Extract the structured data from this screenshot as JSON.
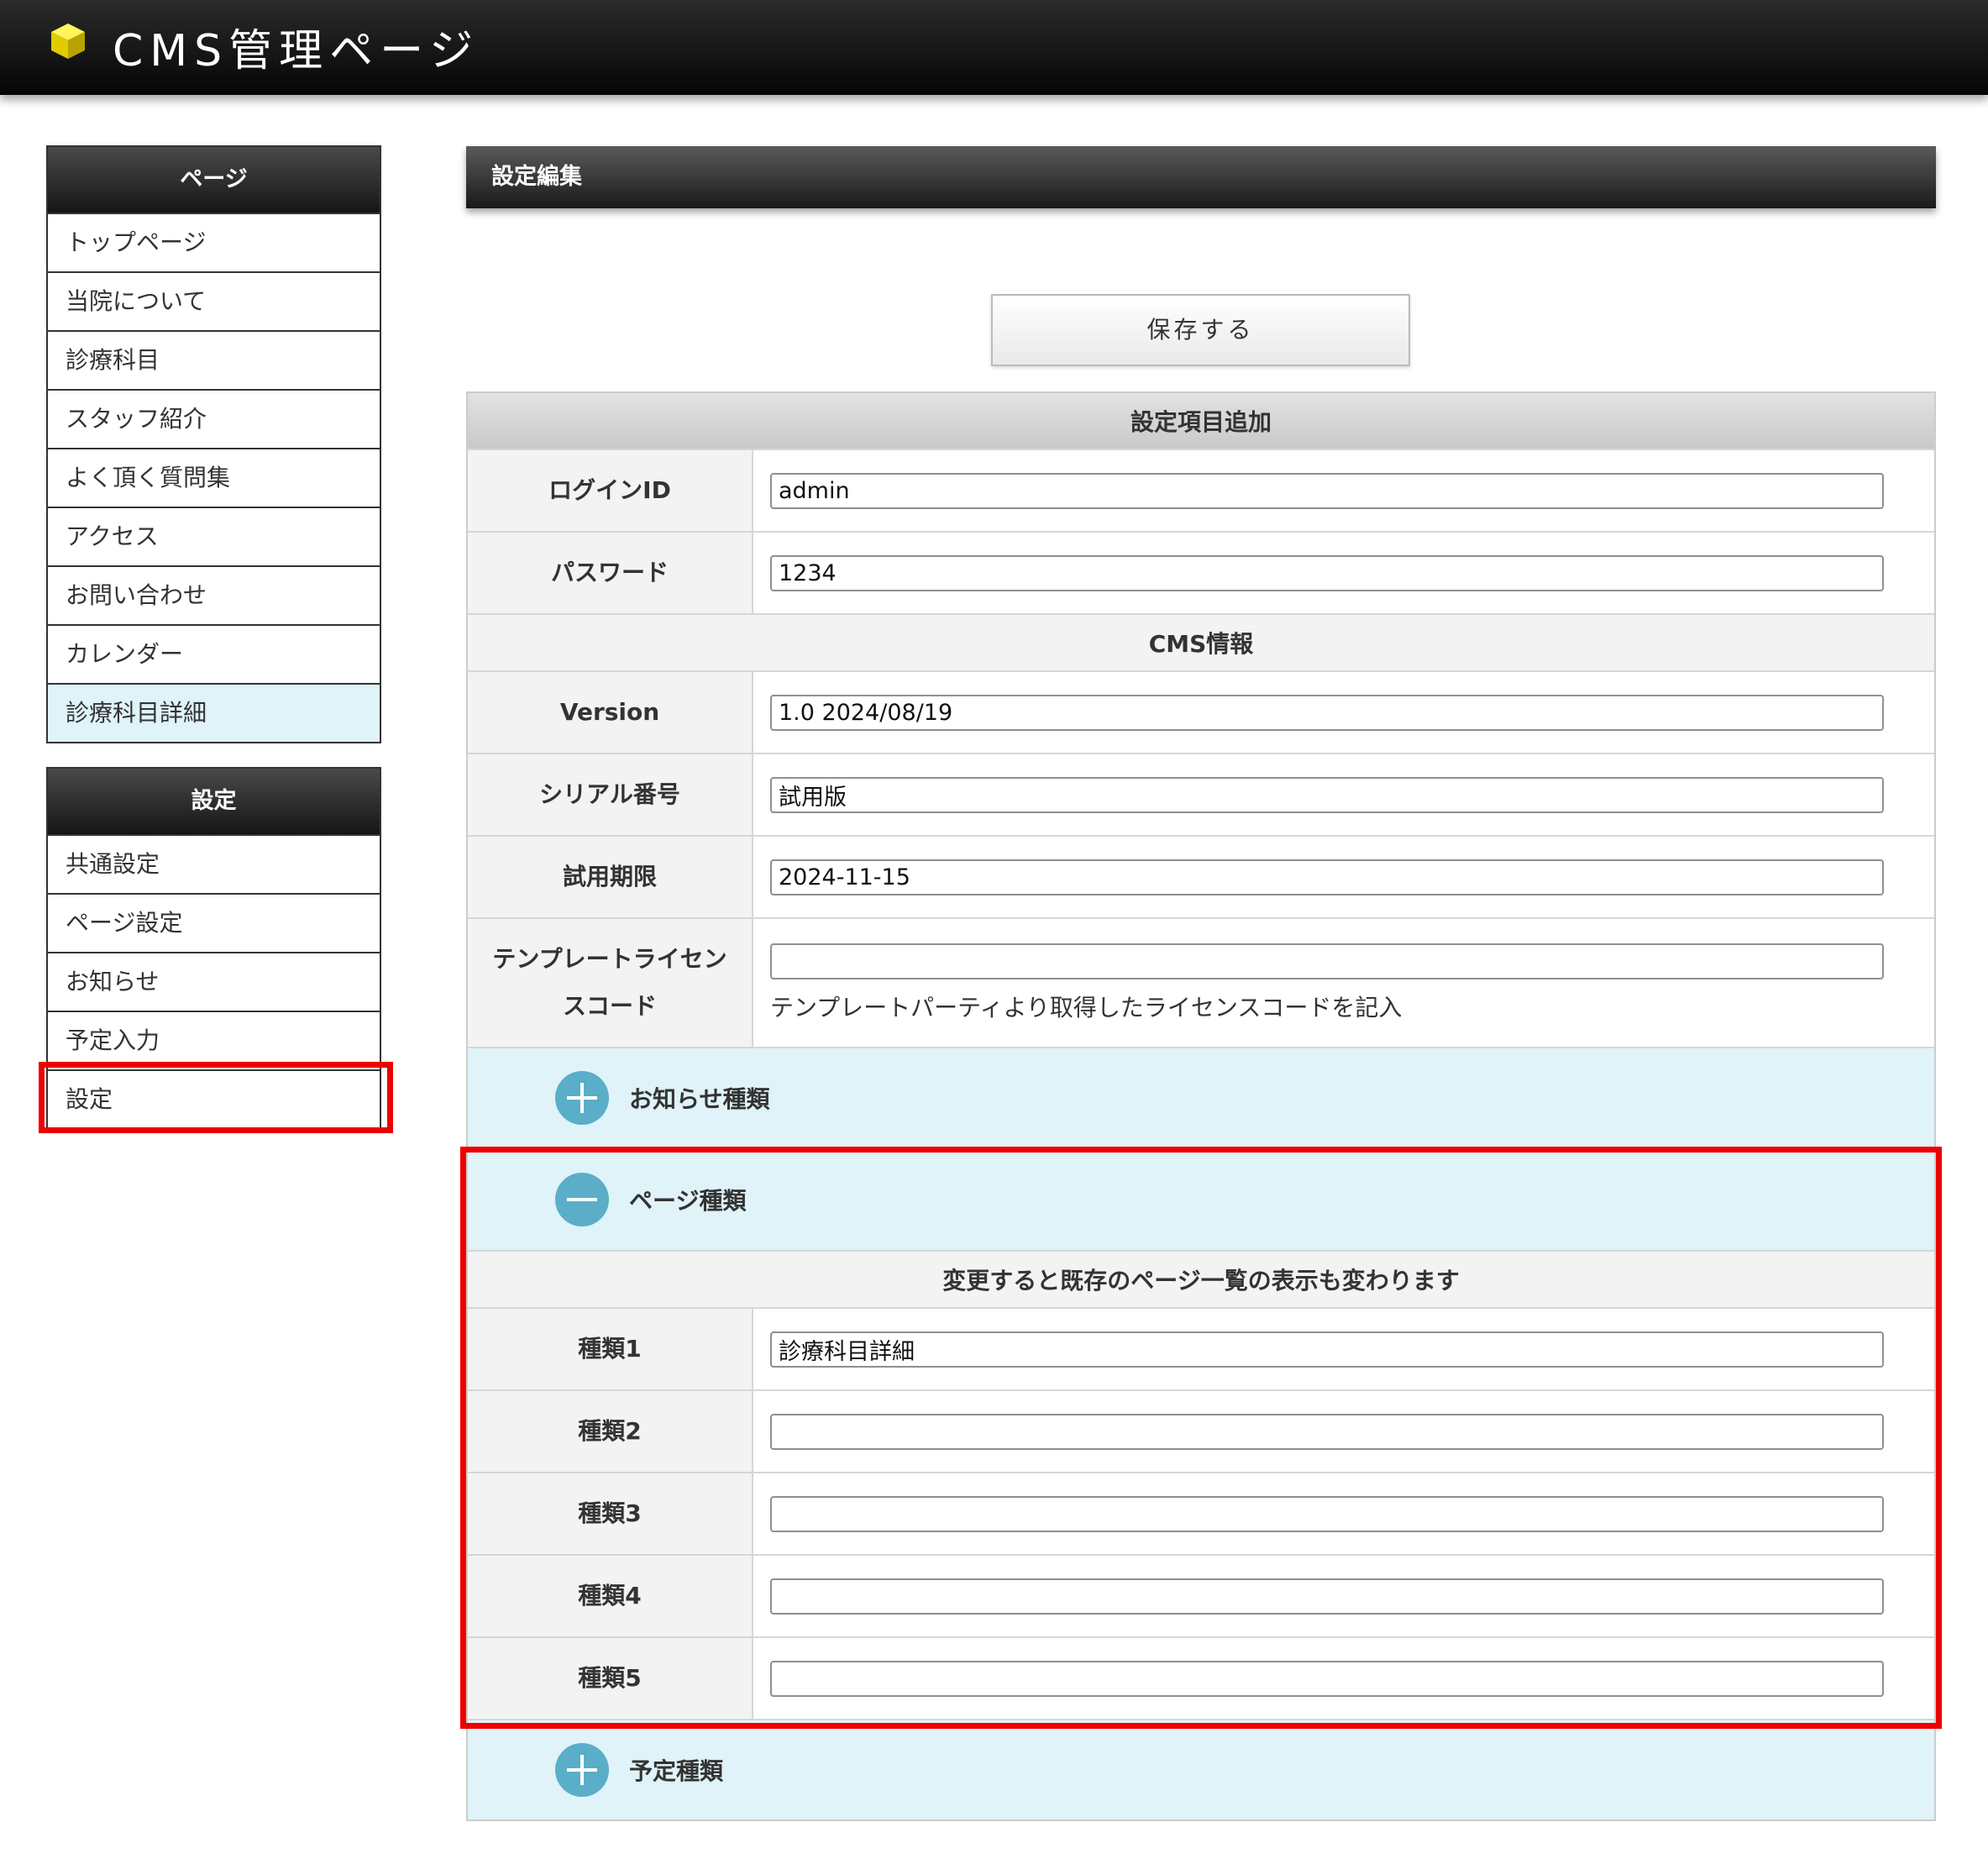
{
  "header": {
    "title": "CMS管理ページ",
    "logo_icon": "yellow-cube-icon"
  },
  "sidebar": {
    "pages": {
      "heading": "ページ",
      "items": [
        "トップページ",
        "当院について",
        "診療科目",
        "スタッフ紹介",
        "よく頂く質問集",
        "アクセス",
        "お問い合わせ",
        "カレンダー",
        "診療科目詳細"
      ],
      "active_item": "診療科目詳細"
    },
    "settings": {
      "heading": "設定",
      "items": [
        "共通設定",
        "ページ設定",
        "お知らせ",
        "予定入力",
        "設定"
      ],
      "highlighted_item": "設定"
    }
  },
  "main": {
    "title": "設定編集",
    "save_label": "保存する",
    "section_add": "設定項目追加",
    "login_id": {
      "label": "ログインID",
      "value": "admin"
    },
    "password": {
      "label": "パスワード",
      "value": "1234"
    },
    "section_cms": "CMS情報",
    "version": {
      "label": "Version",
      "value": "1.0 2024/08/19"
    },
    "serial": {
      "label": "シリアル番号",
      "value": "試用版"
    },
    "trial": {
      "label": "試用期限",
      "value": "2024-11-15"
    },
    "license": {
      "label_line1": "テンプレートライセン",
      "label_line2": "スコード",
      "value": "",
      "help": "テンプレートパーティより取得したライセンスコードを記入"
    },
    "accordions": {
      "news": {
        "label": "お知らせ種類",
        "state": "collapsed"
      },
      "page": {
        "label": "ページ種類",
        "state": "expanded"
      },
      "schedule": {
        "label": "予定種類",
        "state": "collapsed"
      }
    },
    "page_types_notice": "変更すると既存のページ一覧の表示も変わります",
    "page_types": [
      {
        "label": "種類1",
        "value": "診療科目詳細"
      },
      {
        "label": "種類2",
        "value": ""
      },
      {
        "label": "種類3",
        "value": ""
      },
      {
        "label": "種類4",
        "value": ""
      },
      {
        "label": "種類5",
        "value": ""
      }
    ]
  },
  "colors": {
    "accent": "#5aaec7",
    "accordion_bg": "#dff3f9",
    "highlight": "#ee0000"
  }
}
